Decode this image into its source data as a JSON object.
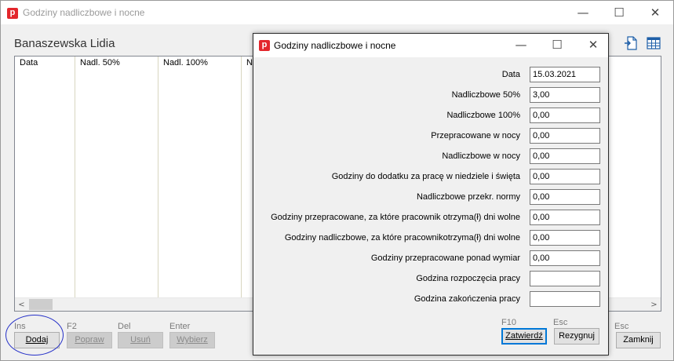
{
  "main_window": {
    "title": "Godziny nadliczbowe i nocne",
    "app_icon_letter": "p",
    "minimize_glyph": "—",
    "maximize_glyph": "☐",
    "close_glyph": "✕",
    "person_name": "Banaszewska Lidia",
    "grid": {
      "columns": [
        "Data",
        "Nadl. 50%",
        "Nadl. 100%",
        "N"
      ]
    },
    "scroll": {
      "left_arrow": "<",
      "right_arrow": ">"
    },
    "buttons": [
      {
        "hint": "Ins",
        "label": "Dodaj",
        "enabled": true
      },
      {
        "hint": "F2",
        "label": "Popraw",
        "enabled": false
      },
      {
        "hint": "Del",
        "label": "Usuń",
        "enabled": false
      },
      {
        "hint": "Enter",
        "label": "Wybierz",
        "enabled": false
      }
    ],
    "close_button": {
      "hint": "Esc",
      "label": "Zamknij"
    },
    "toolbar_icons": [
      "export-document-icon",
      "table-view-icon"
    ],
    "accent_color": "#e3262c",
    "highlight_color": "#2530c8"
  },
  "dialog": {
    "title": "Godziny nadliczbowe i nocne",
    "app_icon_letter": "p",
    "minimize_glyph": "—",
    "maximize_glyph": "☐",
    "close_glyph": "✕",
    "fields": [
      {
        "label": "Data",
        "value": "15.03.2021"
      },
      {
        "label": "Nadliczbowe 50%",
        "value": "3,00"
      },
      {
        "label": "Nadliczbowe 100%",
        "value": "0,00"
      },
      {
        "label": "Przepracowane w nocy",
        "value": "0,00"
      },
      {
        "label": "Nadliczbowe w nocy",
        "value": "0,00"
      },
      {
        "label": "Godziny do dodatku za pracę w niedziele i święta",
        "value": "0,00"
      },
      {
        "label": "Nadliczbowe przekr. normy",
        "value": "0,00"
      },
      {
        "label": "Godziny przepracowane, za które pracownik otrzyma(ł) dni wolne",
        "value": "0,00"
      },
      {
        "label": "Godziny nadliczbowe, za które pracownikotrzyma(ł) dni wolne",
        "value": "0,00"
      },
      {
        "label": "Godziny przepracowane ponad wymiar",
        "value": "0,00"
      },
      {
        "label": "Godzina rozpoczęcia pracy",
        "value": ""
      },
      {
        "label": "Godzina zakończenia pracy",
        "value": ""
      }
    ],
    "confirm": {
      "hint": "F10",
      "label": "Zatwierdź"
    },
    "cancel": {
      "hint": "Esc",
      "label": "Rezygnuj"
    }
  }
}
